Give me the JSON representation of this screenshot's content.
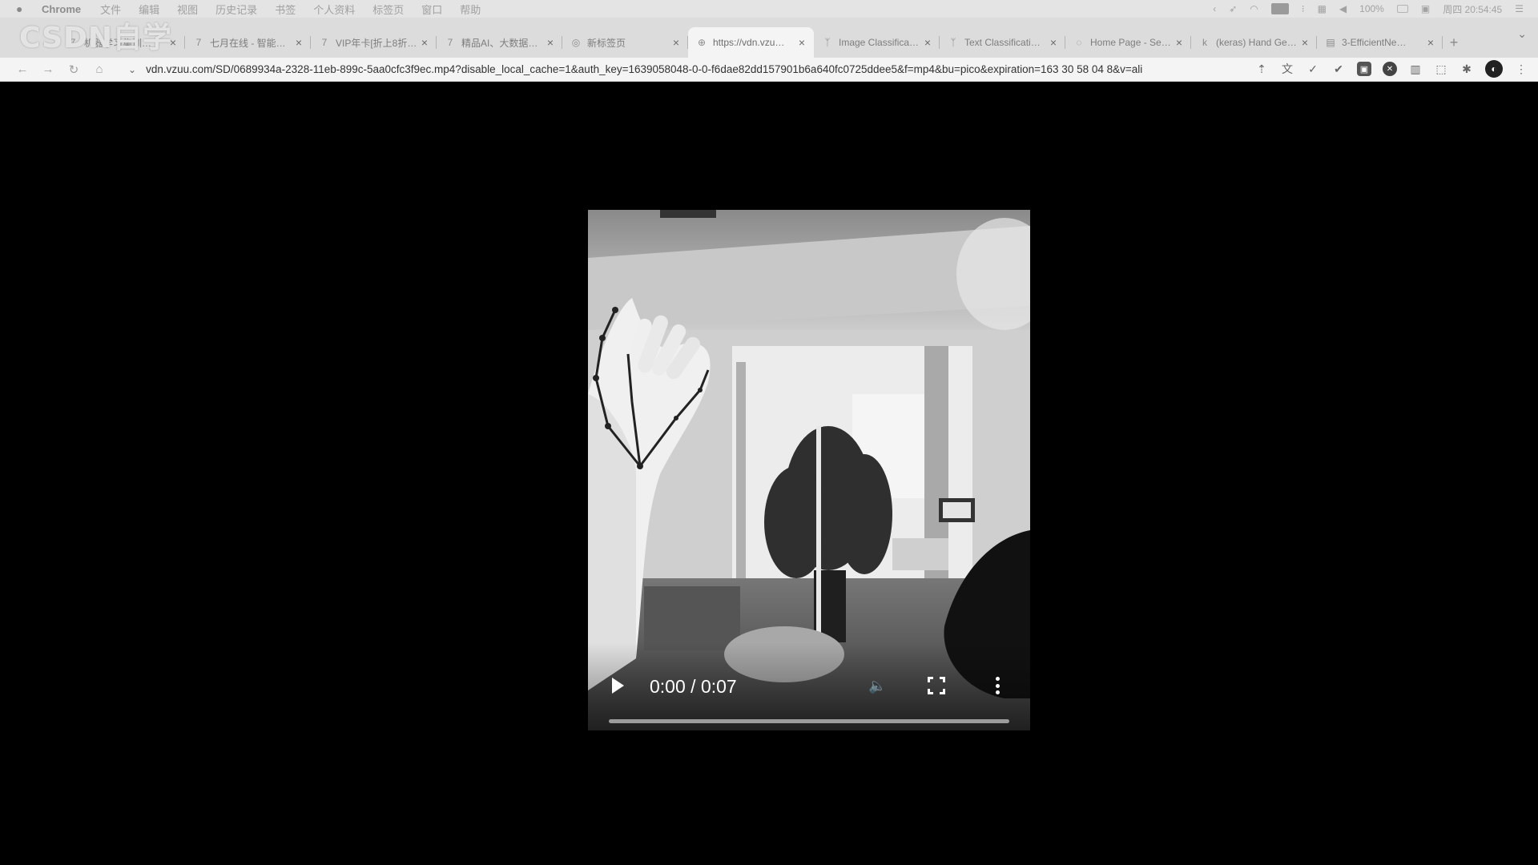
{
  "menubar": {
    "app": "Chrome",
    "items": [
      "文件",
      "编辑",
      "视图",
      "历史记录",
      "书签",
      "个人资料",
      "标签页",
      "窗口",
      "帮助"
    ],
    "battery": "100%",
    "clock": "周四 20:54:45"
  },
  "watermark": "CSDN自学",
  "tabs": [
    {
      "title": "机器学习集训…",
      "icon": "logo-7-icon"
    },
    {
      "title": "七月在线 - 智能…",
      "icon": "logo-7-icon"
    },
    {
      "title": "VIP年卡[折上8折…",
      "icon": "logo-7-icon"
    },
    {
      "title": "精品AI、大数据…",
      "icon": "logo-7-icon"
    },
    {
      "title": "新标签页",
      "icon": "chrome-icon"
    },
    {
      "title": "https://vdn.vzu…",
      "icon": "globe-icon"
    },
    {
      "title": "Image Classifica…",
      "icon": "tf-icon"
    },
    {
      "title": "Text Classificati…",
      "icon": "tf-icon"
    },
    {
      "title": "Home Page - Se…",
      "icon": "loading-icon"
    },
    {
      "title": "(keras) Hand Ge…",
      "icon": "k-icon"
    },
    {
      "title": "3-EfficientNe…",
      "icon": "doc-icon"
    }
  ],
  "toolbar": {
    "url": "vdn.vzuu.com/SD/0689934a-2328-11eb-899c-5aa0cfc3f9ec.mp4?disable_local_cache=1&auth_key=1639058048-0-0-f6dae82dd157901b6a640fc0725ddee5&f=mp4&bu=pico&expiration=163 30 58 04 8&v=ali"
  },
  "video": {
    "current_time": "0:00",
    "separator": "/",
    "duration": "0:07",
    "progress": 0.0
  }
}
